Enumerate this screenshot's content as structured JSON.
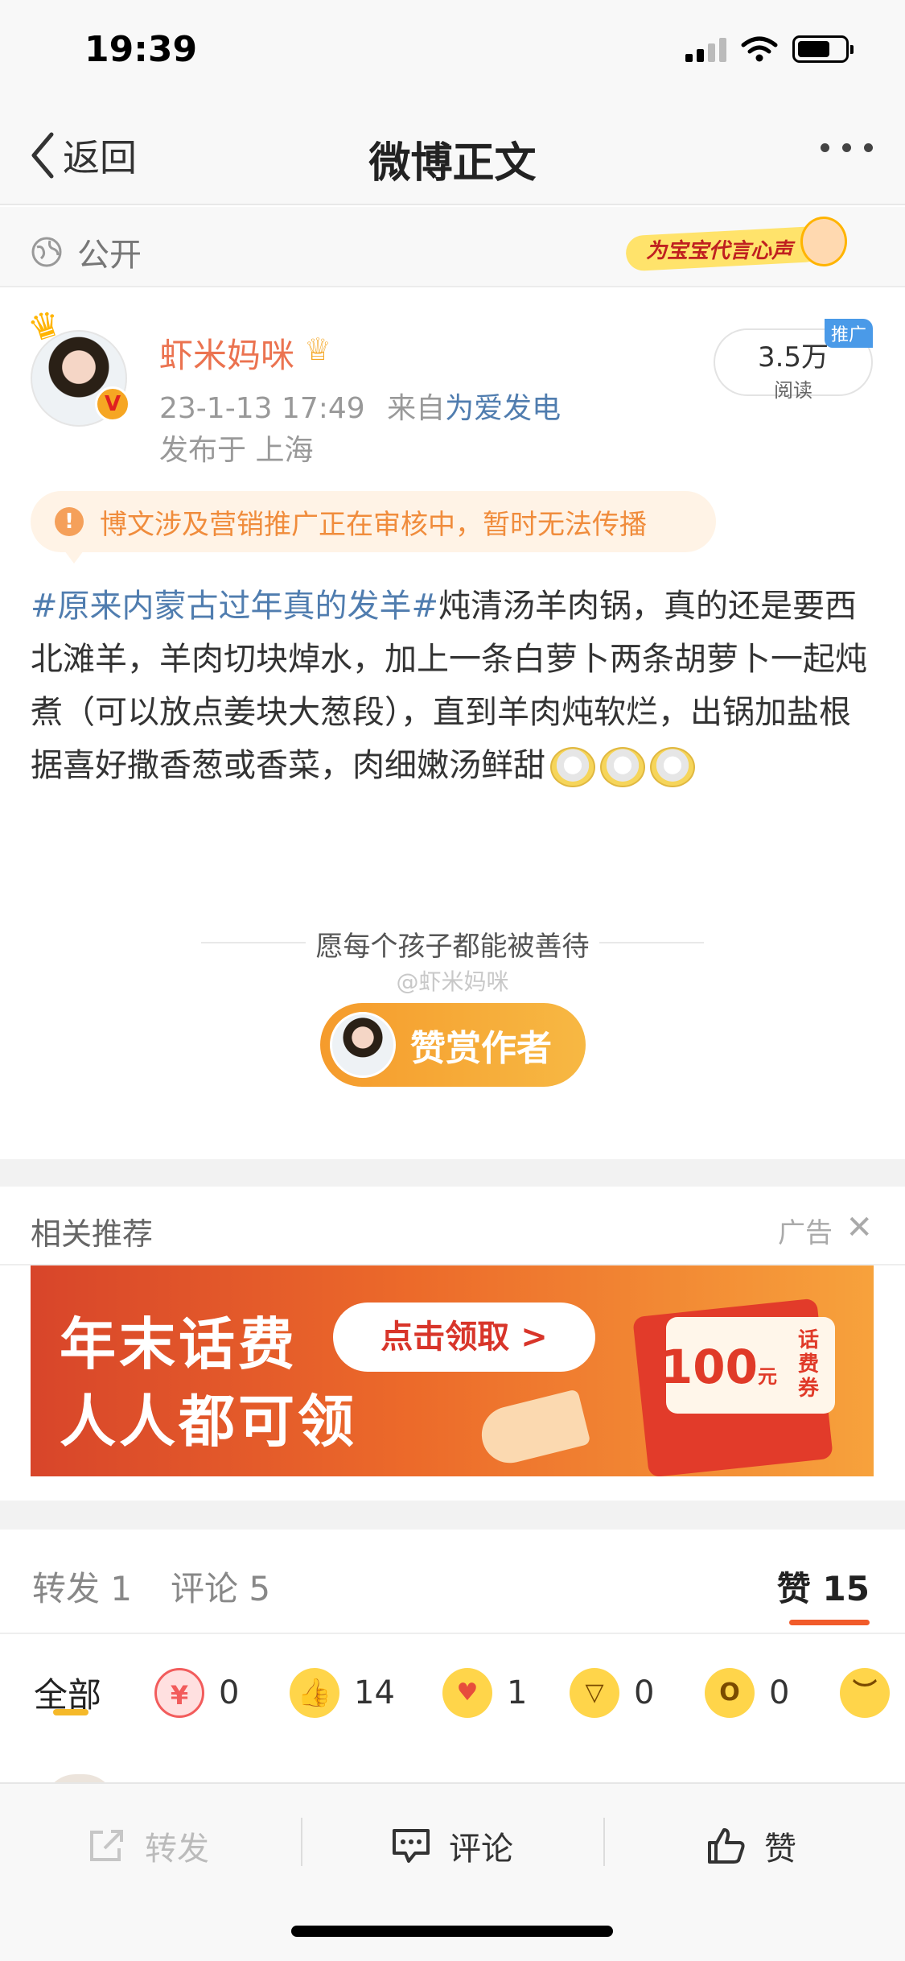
{
  "status_bar": {
    "time": "19:39"
  },
  "nav": {
    "back_label": "返回",
    "title": "微博正文"
  },
  "visibility": {
    "label": "公开",
    "banner_text": "为宝宝代言心声"
  },
  "author": {
    "name": "虾米妈咪",
    "timestamp": "23-1-13 17:49",
    "source_prefix": "来自",
    "source": "为爱发电",
    "location": "发布于 上海",
    "verified_mark": "V"
  },
  "reads": {
    "count": "3.5万",
    "label": "阅读",
    "promo_tag": "推广"
  },
  "warning": {
    "icon": "!",
    "text": "博文涉及营销推广正在审核中，暂时无法传播"
  },
  "post": {
    "hashtag": "#原来内蒙古过年真的发羊#",
    "text": "炖清汤羊肉锅，真的还是要西北滩羊，羊肉切块焯水，加上一条白萝卜两条胡萝卜一起炖煮（可以放点姜块大葱段），直到羊肉炖软烂，出锅加盐根据喜好撒香葱或香菜，肉细嫩汤鲜甜",
    "emoji_count": 3
  },
  "reward": {
    "subtitle": "愿每个孩子都能被善待",
    "watermark": "@虾米妈咪",
    "button_label": "赞赏作者"
  },
  "recommend": {
    "title": "相关推荐",
    "ad_label": "广告",
    "close_icon": "close-icon"
  },
  "ad_banner": {
    "line1": "年末话费",
    "line2": "人人都可领",
    "cta": "点击领取 >",
    "amount": "100",
    "amount_unit": "元",
    "ticket_label": "话费券"
  },
  "stats": {
    "repost": "转发 1",
    "comment": "评论 5",
    "like": "赞 15"
  },
  "reactions": {
    "all_label": "全部",
    "items": [
      {
        "icon": "heart-yuan-icon",
        "glyph": "¥",
        "count": "0"
      },
      {
        "icon": "thumbs-up-icon",
        "glyph": "👍",
        "count": "14"
      },
      {
        "icon": "kiss-face-icon",
        "glyph": "♥",
        "count": "1"
      },
      {
        "icon": "laugh-face-icon",
        "glyph": "▽",
        "count": "0"
      },
      {
        "icon": "surprised-face-icon",
        "glyph": "O",
        "count": "0"
      },
      {
        "icon": "sad-face-icon",
        "glyph": "︶",
        "count": ""
      }
    ]
  },
  "bottom_bar": {
    "repost_label": "转发",
    "comment_label": "评论",
    "like_label": "赞"
  },
  "colors": {
    "accent_orange": "#eb7350",
    "link_blue": "#507daf",
    "tab_underline": "#f15b2a"
  }
}
